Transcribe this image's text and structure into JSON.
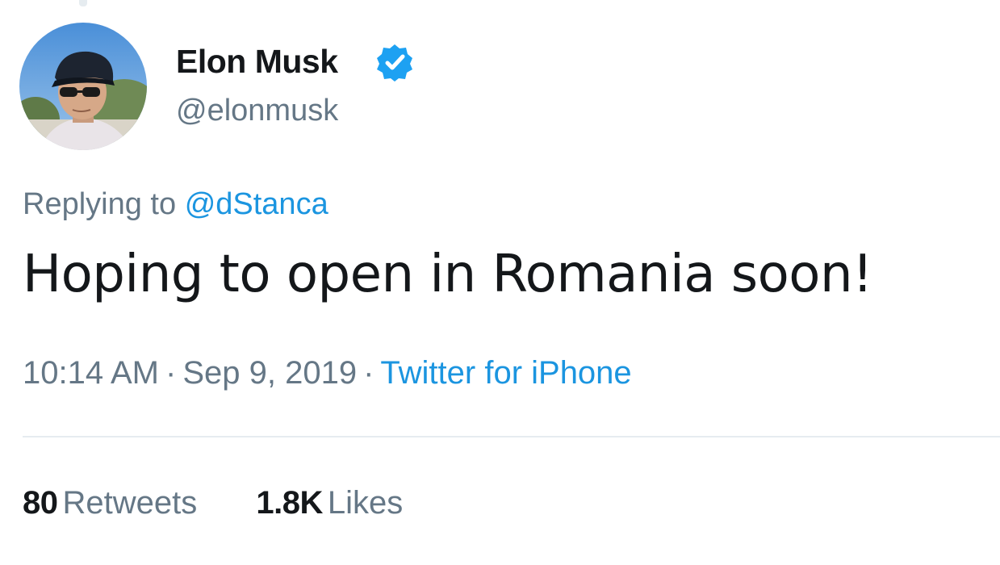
{
  "author": {
    "display_name": "Elon Musk",
    "handle": "@elonmusk",
    "verified_icon": "verified-badge-icon",
    "avatar_icon": "profile-photo"
  },
  "reply": {
    "prefix": "Replying to",
    "mention": "@dStanca"
  },
  "tweet": {
    "text": "Hoping to open in Romania soon!"
  },
  "meta": {
    "time": "10:14 AM",
    "separator": "·",
    "date": "Sep 9, 2019",
    "source": "Twitter for iPhone"
  },
  "stats": {
    "retweets_count": "80",
    "retweets_label": "Retweets",
    "likes_count": "1.8K",
    "likes_label": "Likes"
  },
  "colors": {
    "link": "#1b95e0",
    "secondary_text": "#657786",
    "primary_text": "#14171a",
    "verified": "#1da1f2",
    "divider": "#e6ecf0"
  }
}
